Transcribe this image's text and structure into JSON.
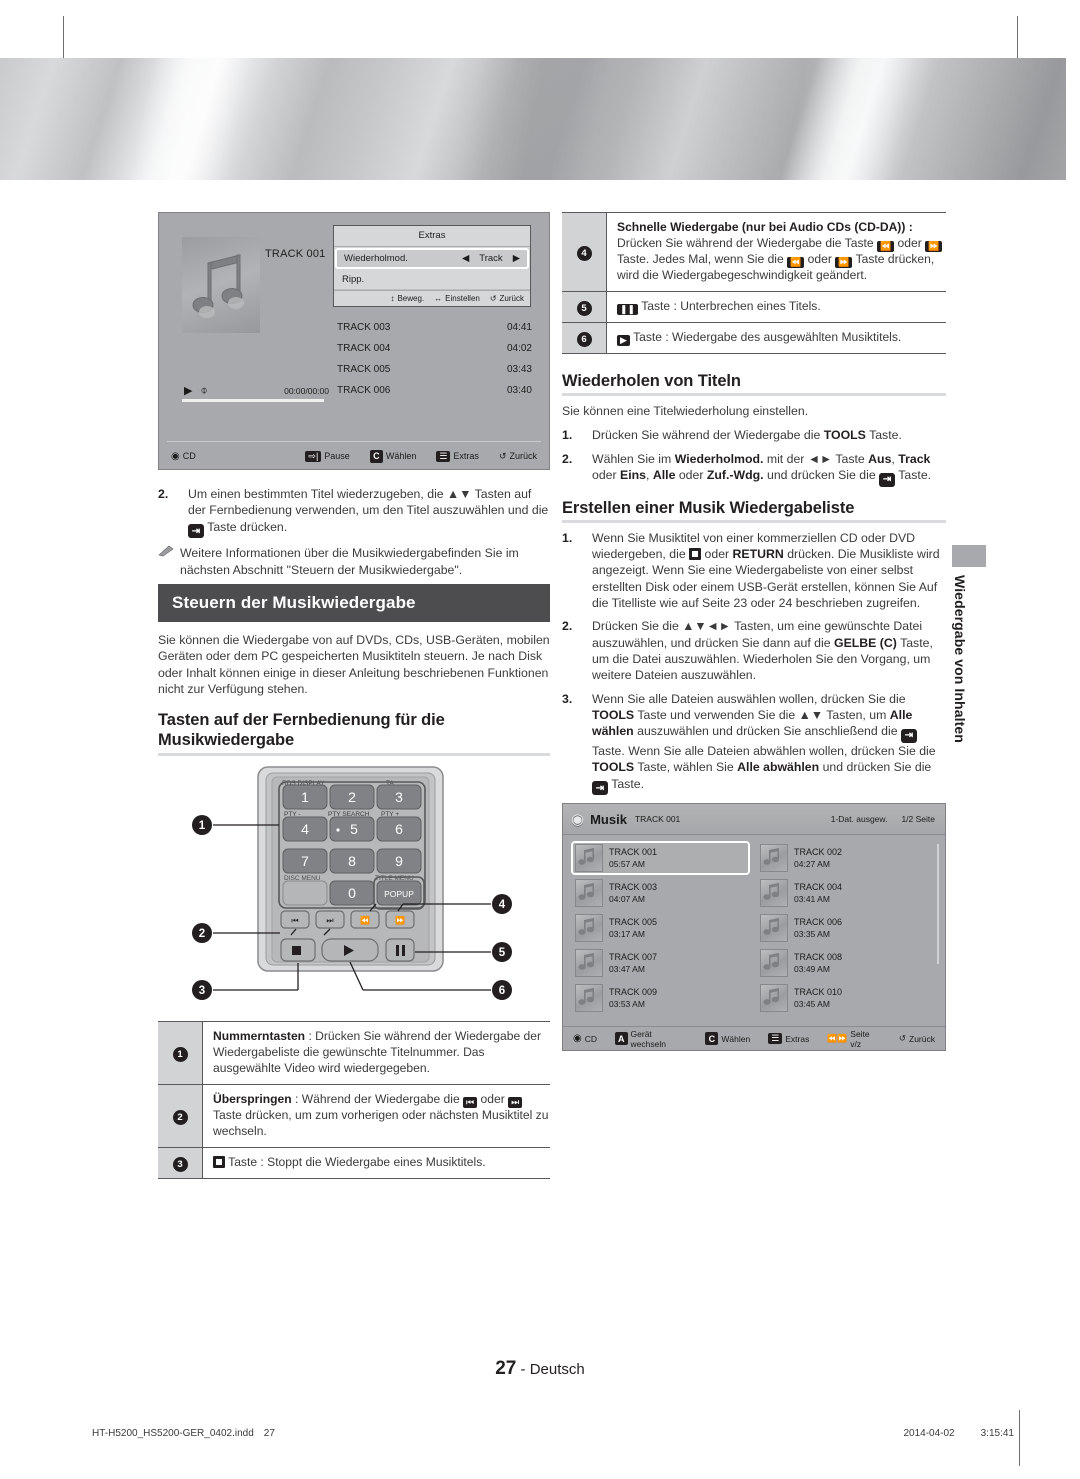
{
  "page": {
    "number": "27",
    "language": "- Deutsch",
    "imprint_file": "HT-H5200_HS5200-GER_0402.indd",
    "imprint_page": "27",
    "imprint_date": "2014-04-02",
    "imprint_time": "3:15:41",
    "side_tab": "Wiedergabe von Inhalten"
  },
  "player_screenshot": {
    "track_title": "TRACK 001",
    "time_display": "00:00/00:00",
    "tracks": [
      {
        "name": "TRACK 003",
        "time": "04:41"
      },
      {
        "name": "TRACK 004",
        "time": "04:02"
      },
      {
        "name": "TRACK 005",
        "time": "03:43"
      },
      {
        "name": "TRACK 006",
        "time": "03:40"
      }
    ],
    "extras": {
      "title": "Extras",
      "rows": [
        {
          "label": "Wiederholmod.",
          "value": "Track"
        },
        {
          "label": "Ripp.",
          "value": ""
        }
      ],
      "footer": [
        {
          "icon": "up-down-arrow-icon",
          "label": "Beweg."
        },
        {
          "icon": "left-right-arrow-icon",
          "label": "Einstellen"
        },
        {
          "icon": "return-arrow-icon",
          "label": "Zurück"
        }
      ]
    },
    "bottom_bar": {
      "source": "CD",
      "actions": [
        {
          "icon": "enter-key-icon",
          "label": "Pause"
        },
        {
          "icon": "c-key-icon",
          "label": "Wählen"
        },
        {
          "icon": "tools-key-icon",
          "label": "Extras"
        },
        {
          "icon": "return-arrow-icon",
          "label": "Zurück"
        }
      ]
    }
  },
  "left_column": {
    "step2": {
      "num": "2.",
      "text_a": "Um einen bestimmten Titel wiederzugeben, die ▲▼ Tasten auf der Fernbedienung verwenden, um den Titel auszuwählen und die ",
      "text_b": " Taste drücken."
    },
    "note": "Weitere Informationen über die Musikwiedergabefinden Sie im nächsten Abschnitt \"Steuern der Musikwiedergabe\".",
    "heading_bar": "Steuern der Musikwiedergabe",
    "intro": "Sie können die Wiedergabe von auf DVDs, CDs, USB-Geräten, mobilen Geräten oder dem PC gespeicherten Musiktiteln steuern. Je nach Disk oder Inhalt können einige in dieser Anleitung beschriebenen Funktionen nicht zur Verfügung stehen.",
    "sub_heading": "Tasten auf der Fernbedienung für die Musikwiedergabe",
    "remote": {
      "keys": [
        "1",
        "2",
        "3",
        "4",
        "5",
        "6",
        "7",
        "8",
        "9",
        "0"
      ],
      "labels": [
        "RDS DISPLAY",
        "TA",
        "PTY -",
        "PTY SEARCH",
        "PTY +",
        "DISC MENU",
        "TITLE MENU",
        "POPUP"
      ],
      "callouts": [
        "1",
        "2",
        "3",
        "4",
        "5",
        "6"
      ]
    },
    "table": [
      {
        "num": "1",
        "bold": "Nummerntasten",
        "text": " : Drücken Sie während der Wiedergabe der Wiedergabeliste  die gewünschte Titelnummer. Das ausgewählte Video wird wiedergegeben."
      },
      {
        "num": "2",
        "bold": "Überspringen",
        "text_a": " : Während der Wiedergabe die ",
        "text_b": " oder ",
        "text_c": " Taste drücken, um zum vorherigen oder nächsten Musiktitel zu wechseln."
      },
      {
        "num": "3",
        "text_a": " Taste : Stoppt die Wiedergabe eines Musiktitels."
      }
    ]
  },
  "right_column": {
    "table": [
      {
        "num": "4",
        "bold": "Schnelle Wiedergabe (nur bei Audio CDs (CD-DA)) :",
        "p1": "Drücken Sie während der Wiedergabe die Taste ",
        "p2": " oder ",
        "p3": " Taste. Jedes Mal, wenn Sie die ",
        "p4": " oder ",
        "p5": " Taste drücken, wird die Wiedergabegeschwindigkeit geändert."
      },
      {
        "num": "5",
        "text": " Taste : Unterbrechen eines Titels."
      },
      {
        "num": "6",
        "text": " Taste : Wiedergabe des ausgewählten Musiktitels."
      }
    ],
    "repeat_section": {
      "heading": "Wiederholen von Titeln",
      "intro": "Sie können eine Titelwiederholung einstellen.",
      "step1_num": "1.",
      "step1_a": "Drücken Sie während der Wiedergabe die ",
      "step1_bold": "TOOLS",
      "step1_b": " Taste.",
      "step2_num": "2.",
      "step2_a": "Wählen Sie im ",
      "step2_b1": "Wiederholmod.",
      "step2_c": " mit der ◄► Taste ",
      "step2_b2": "Aus",
      "step2_d": ", ",
      "step2_b3": "Track",
      "step2_e": " oder ",
      "step2_b4": "Eins",
      "step2_f": ", ",
      "step2_b5": "Alle",
      "step2_g": " oder ",
      "step2_b6": "Zuf.-Wdg.",
      "step2_h": " und drücken Sie die ",
      "step2_i": " Taste."
    },
    "playlist_section": {
      "heading": "Erstellen einer Musik Wiedergabeliste",
      "steps": [
        {
          "num": "1.",
          "a": "Wenn Sie Musiktitel von einer kommerziellen CD oder DVD wiedergeben, die ",
          "b": " oder ",
          "bold": "RETURN",
          "c": " drücken. Die Musikliste wird angezeigt. Wenn Sie eine Wiedergabeliste von einer selbst erstellten Disk oder einem USB-Gerät erstellen, können Sie Auf die Titelliste wie auf Seite 23 oder 24 beschrieben zugreifen."
        },
        {
          "num": "2.",
          "a": "Drücken Sie die ▲▼◄► Tasten, um eine gewünschte Datei auszuwählen, und drücken Sie dann auf die ",
          "bold": "GELBE (C)",
          "c": " Taste, um die Datei auszuwählen. Wiederholen Sie den Vorgang, um weitere Dateien auszuwählen."
        },
        {
          "num": "3.",
          "a": "Wenn Sie alle Dateien auswählen wollen, drücken Sie die ",
          "bold1": "TOOLS",
          "b": " Taste und verwenden Sie die ▲▼ Tasten, um ",
          "bold2": "Alle wählen",
          "c": " auszuwählen und drücken Sie anschließend die ",
          "d": " Taste. Wenn Sie alle Dateien abwählen wollen, drücken Sie die ",
          "bold3": "TOOLS",
          "e": " Taste, wählen Sie ",
          "bold4": "Alle abwählen",
          "f": " und drücken Sie die ",
          "g": " Taste."
        }
      ]
    },
    "musik_screenshot": {
      "title": "Musik",
      "subtitle": "TRACK 001",
      "selected_info": "1-Dat. ausgew.",
      "page_info": "1/2 Seite",
      "items": [
        {
          "name": "TRACK 001",
          "time": "05:57 AM",
          "selected": true
        },
        {
          "name": "TRACK 002",
          "time": "04:27 AM",
          "selected": false
        },
        {
          "name": "TRACK 003",
          "time": "04:07 AM",
          "selected": false
        },
        {
          "name": "TRACK 004",
          "time": "03:41 AM",
          "selected": false
        },
        {
          "name": "TRACK 005",
          "time": "03:17 AM",
          "selected": false
        },
        {
          "name": "TRACK 006",
          "time": "03:35 AM",
          "selected": false
        },
        {
          "name": "TRACK 007",
          "time": "03:47 AM",
          "selected": false
        },
        {
          "name": "TRACK 008",
          "time": "03:49 AM",
          "selected": false
        },
        {
          "name": "TRACK 009",
          "time": "03:53 AM",
          "selected": false
        },
        {
          "name": "TRACK 010",
          "time": "03:45 AM",
          "selected": false
        }
      ],
      "footer": {
        "source": "CD",
        "actions": [
          {
            "icon": "a-key-icon",
            "label": "Gerät wechseln"
          },
          {
            "icon": "c-key-icon",
            "label": "Wählen"
          },
          {
            "icon": "tools-key-icon",
            "label": "Extras"
          },
          {
            "icon": "skip-icon",
            "label": "Seite v/z"
          },
          {
            "icon": "return-arrow-icon",
            "label": "Zurück"
          }
        ]
      }
    }
  },
  "colors": {
    "heading_bar_bg": "#4d4d4f",
    "rule": "#d9dadb",
    "tv_bg": "#a7a9ac",
    "ink": "#231f20"
  }
}
